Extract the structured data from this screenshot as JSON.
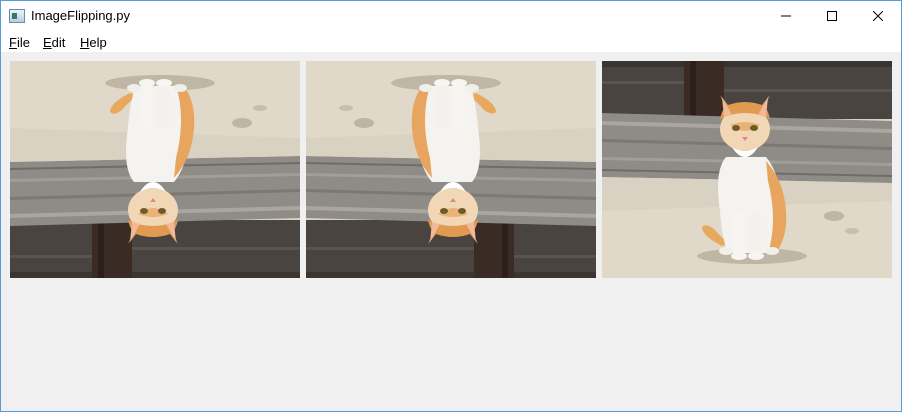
{
  "window": {
    "title": "ImageFlipping.py"
  },
  "titlebar": {
    "icon": "python-window-icon",
    "controls": [
      "minimize-icon",
      "maximize-icon",
      "close-icon"
    ]
  },
  "menu": {
    "file": {
      "mnemonic": "F",
      "rest": "ile"
    },
    "edit": {
      "mnemonic": "E",
      "rest": "dit"
    },
    "help": {
      "mnemonic": "H",
      "rest": "elp"
    }
  },
  "images": [
    {
      "subject": "cat on wooden bench",
      "orientation": "flipped vertically"
    },
    {
      "subject": "cat on wooden bench",
      "orientation": "flipped vertically and horizontally"
    },
    {
      "subject": "cat on wooden bench",
      "orientation": "original"
    }
  ],
  "colors": {
    "window_border": "#5b9bd5",
    "client_background": "#f0f0f0"
  }
}
